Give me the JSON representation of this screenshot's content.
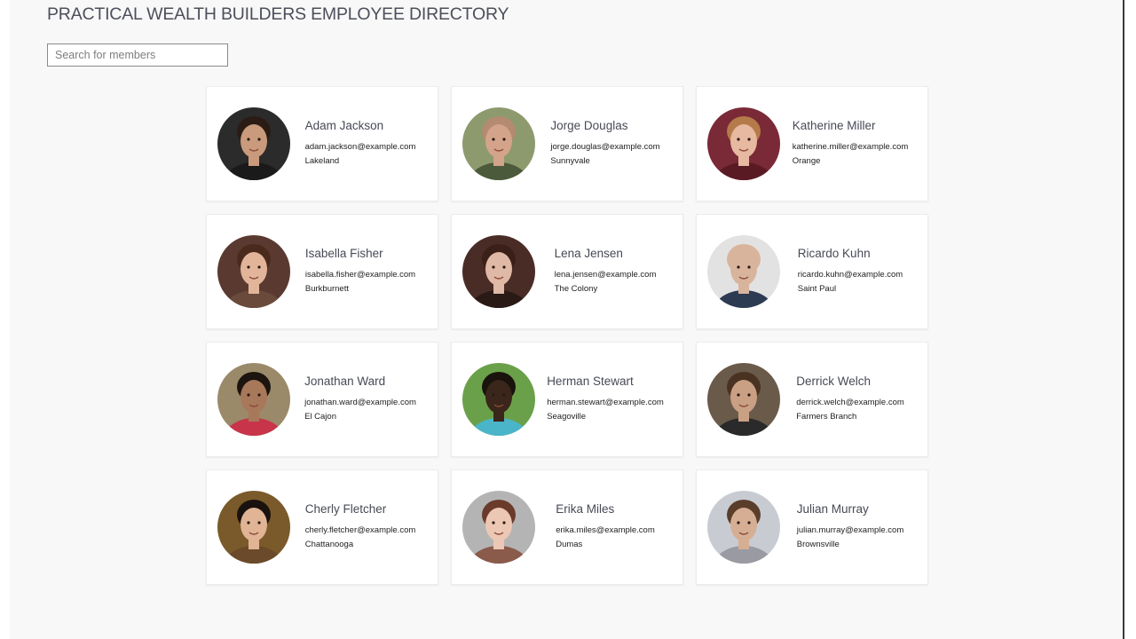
{
  "header": {
    "title": "PRACTICAL WEALTH BUILDERS EMPLOYEE DIRECTORY"
  },
  "search": {
    "placeholder": "Search for members",
    "value": ""
  },
  "members": [
    {
      "name": "Adam Jackson",
      "email": "adam.jackson@example.com",
      "city": "Lakeland",
      "photo": {
        "bg": "#2b2b2b",
        "skin": "#c99a7c",
        "hair": "#2a1c14",
        "shirt": "#1a1a1a"
      }
    },
    {
      "name": "Jorge Douglas",
      "email": "jorge.douglas@example.com",
      "city": "Sunnyvale",
      "photo": {
        "bg": "#8d9a6e",
        "skin": "#d3a48a",
        "hair": "#b48a70",
        "shirt": "#4a5a3a"
      }
    },
    {
      "name": "Katherine Miller",
      "email": "katherine.miller@example.com",
      "city": "Orange",
      "photo": {
        "bg": "#7a2a36",
        "skin": "#e6b9a0",
        "hair": "#b47a4a",
        "shirt": "#5a1a24"
      }
    },
    {
      "name": "Isabella Fisher",
      "email": "isabella.fisher@example.com",
      "city": "Burkburnett",
      "photo": {
        "bg": "#5a3a30",
        "skin": "#e2b59a",
        "hair": "#4a2a1c",
        "shirt": "#6a4a3a"
      }
    },
    {
      "name": "Lena Jensen",
      "email": "lena.jensen@example.com",
      "city": "The Colony",
      "photo": {
        "bg": "#4a2c26",
        "skin": "#e0b8a6",
        "hair": "#3a2018",
        "shirt": "#2a1a16"
      }
    },
    {
      "name": "Ricardo Kuhn",
      "email": "ricardo.kuhn@example.com",
      "city": "Saint Paul",
      "photo": {
        "bg": "#e2e2e2",
        "skin": "#d9b49c",
        "hair": "#d9b49c",
        "shirt": "#2c3a52"
      }
    },
    {
      "name": "Jonathan Ward",
      "email": "jonathan.ward@example.com",
      "city": "El Cajon",
      "photo": {
        "bg": "#9a8a6a",
        "skin": "#a8785a",
        "hair": "#1c140e",
        "shirt": "#c8344a"
      }
    },
    {
      "name": "Herman Stewart",
      "email": "herman.stewart@example.com",
      "city": "Seagoville",
      "photo": {
        "bg": "#6aa04a",
        "skin": "#3a261a",
        "hair": "#1a120c",
        "shirt": "#4ab4c8"
      }
    },
    {
      "name": "Derrick Welch",
      "email": "derrick.welch@example.com",
      "city": "Farmers Branch",
      "photo": {
        "bg": "#6a5a4a",
        "skin": "#caa084",
        "hair": "#4a3222",
        "shirt": "#2a2a2a"
      }
    },
    {
      "name": "Cherly Fletcher",
      "email": "cherly.fletcher@example.com",
      "city": "Chattanooga",
      "photo": {
        "bg": "#7a5a2a",
        "skin": "#e0b494",
        "hair": "#1a120e",
        "shirt": "#6a4a2a"
      }
    },
    {
      "name": "Erika Miles",
      "email": "erika.miles@example.com",
      "city": "Dumas",
      "photo": {
        "bg": "#b4b4b4",
        "skin": "#ecc8b4",
        "hair": "#6a3a2a",
        "shirt": "#8a5a4a"
      }
    },
    {
      "name": "Julian Murray",
      "email": "julian.murray@example.com",
      "city": "Brownsville",
      "photo": {
        "bg": "#c8ccd2",
        "skin": "#d6ae94",
        "hair": "#5a3e2a",
        "shirt": "#9a9aa2"
      }
    }
  ]
}
